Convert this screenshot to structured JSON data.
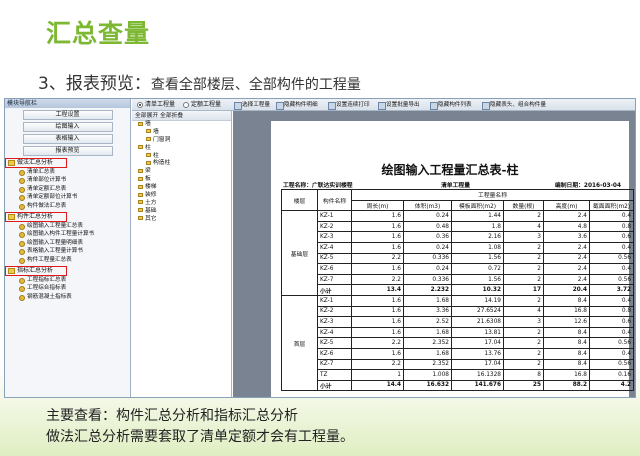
{
  "slide": {
    "title": "汇总查量",
    "subtitle_main": "3、报表预览：",
    "subtitle_rest": "查看全部楼层、全部构件的工程量",
    "note_line1": "主要查看：构件汇总分析和指标汇总分析",
    "note_line2": "做法汇总分析需要套取了清单定额才会有工程量。"
  },
  "nav": {
    "header": "模块导航栏",
    "buttons": [
      "工程设置",
      "绘图输入",
      "表格输入",
      "报表预览"
    ],
    "groups": [
      {
        "title": "做法汇总分析",
        "items": [
          "清单汇总表",
          "清单部位计算书",
          "清单定额汇总表",
          "清单定额部位计算书",
          "构件做法汇总表"
        ]
      },
      {
        "title": "构件汇总分析",
        "items": [
          "绘图输入工程量汇总表",
          "绘图输入构件工程量计算书",
          "绘图输入工程量明细表",
          "表格输入工程量计算书",
          "构件工程量汇总表"
        ]
      },
      {
        "title": "指标汇总分析",
        "items": [
          "工程指标汇总表",
          "工程综合指标表",
          "钢筋混凝土指标表"
        ]
      }
    ]
  },
  "tabs": {
    "tab1": "清单工程量",
    "tab2": "定额工程量"
  },
  "toolbar": [
    "选择工程量",
    "隐藏构件明细",
    "设置连续打印",
    "设置批量导出",
    "隐藏构件列表",
    "隐藏表头、组合构件量"
  ],
  "tree": {
    "header": "全部展开  全部折叠",
    "items": [
      "墙",
      "墙",
      "门窗洞",
      "柱",
      "柱",
      "构造柱",
      "梁",
      "板",
      "楼梯",
      "装修",
      "土方",
      "基础",
      "其它"
    ]
  },
  "report": {
    "title": "绘图输入工程量汇总表-柱",
    "project_label": "工程名称：广联达实训楼程",
    "table_label": "清单工程量",
    "date_label": "编制日期：2016-03-04",
    "col_floor": "楼层",
    "col_name": "构件名称",
    "col_group": "工程量名称",
    "subcols": [
      "周长(m)",
      "体积(m3)",
      "模板面积(m2)",
      "数量(根)",
      "高度(m)",
      "截面面积(m2)"
    ],
    "floors": [
      {
        "name": "基础层",
        "rows": [
          [
            "KZ-1",
            "1.6",
            "0.24",
            "1.44",
            "2",
            "2.4",
            "0.4"
          ],
          [
            "KZ-2",
            "1.6",
            "0.48",
            "1.8",
            "4",
            "4.8",
            "0.8"
          ],
          [
            "KZ-3",
            "1.6",
            "0.36",
            "2.16",
            "3",
            "3.6",
            "0.6"
          ],
          [
            "KZ-4",
            "1.6",
            "0.24",
            "1.08",
            "2",
            "2.4",
            "0.4"
          ],
          [
            "KZ-5",
            "2.2",
            "0.336",
            "1.56",
            "2",
            "2.4",
            "0.56"
          ],
          [
            "KZ-6",
            "1.6",
            "0.24",
            "0.72",
            "2",
            "2.4",
            "0.4"
          ],
          [
            "KZ-7",
            "2.2",
            "0.336",
            "1.56",
            "2",
            "2.4",
            "0.56"
          ]
        ],
        "subtotal": [
          "小计",
          "13.4",
          "2.232",
          "10.32",
          "17",
          "20.4",
          "3.72"
        ]
      },
      {
        "name": "首层",
        "rows": [
          [
            "KZ-1",
            "1.6",
            "1.68",
            "14.19",
            "2",
            "8.4",
            "0.4"
          ],
          [
            "KZ-2",
            "1.6",
            "3.36",
            "27.6524",
            "4",
            "16.8",
            "0.8"
          ],
          [
            "KZ-3",
            "1.6",
            "2.52",
            "21.6308",
            "3",
            "12.6",
            "0.6"
          ],
          [
            "KZ-4",
            "1.6",
            "1.68",
            "13.81",
            "2",
            "8.4",
            "0.4"
          ],
          [
            "KZ-5",
            "2.2",
            "2.352",
            "17.04",
            "2",
            "8.4",
            "0.56"
          ],
          [
            "KZ-6",
            "1.6",
            "1.68",
            "13.76",
            "2",
            "8.4",
            "0.4"
          ],
          [
            "KZ-7",
            "2.2",
            "2.352",
            "17.04",
            "2",
            "8.4",
            "0.56"
          ],
          [
            "TZ",
            "1",
            "1.008",
            "16.1328",
            "8",
            "16.8",
            "0.16"
          ]
        ],
        "subtotal": [
          "小计",
          "14.4",
          "16.632",
          "141.676",
          "25",
          "88.2",
          "4.2"
        ]
      }
    ]
  },
  "colors": {
    "title_green": "#7cb832",
    "highlight_red": "#e01a1a"
  }
}
